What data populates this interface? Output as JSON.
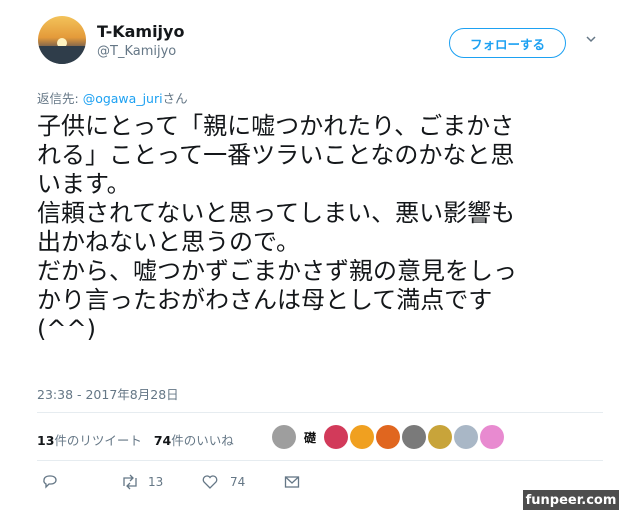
{
  "user": {
    "display_name": "T-Kamijyo",
    "handle": "@T_Kamijyo"
  },
  "follow_button": {
    "label": "フォローする"
  },
  "reply": {
    "prefix": "返信先: ",
    "mention": "@ogawa_juri",
    "suffix": "さん"
  },
  "tweet": {
    "text": "子供にとって「親に嘘つかれたり、ごまかさ\nれる」ことって一番ツラいことなのかなと思\nいます。\n信頼されてないと思ってしまい、悪い影響も\n出かねないと思うので。\nだから、嘘つかずごまかさず親の意見をしっ\nかり言ったおがわさんは母として満点です\n(^^)",
    "timestamp": "23:38 - 2017年8月28日"
  },
  "stats": {
    "retweet_count": "13",
    "retweet_label": "件のリツイート",
    "like_count": "74",
    "like_label": "件のいいね"
  },
  "likers": [
    {
      "name": "liker-1",
      "color": "#9e9e9e",
      "glyph": ""
    },
    {
      "name": "liker-2",
      "color": "#ffffff",
      "glyph": "礎"
    },
    {
      "name": "liker-3",
      "color": "#d23a5a",
      "glyph": ""
    },
    {
      "name": "liker-4",
      "color": "#f0a020",
      "glyph": ""
    },
    {
      "name": "liker-5",
      "color": "#e0661f",
      "glyph": ""
    },
    {
      "name": "liker-6",
      "color": "#7a7a7a",
      "glyph": ""
    },
    {
      "name": "liker-7",
      "color": "#c8a43a",
      "glyph": ""
    },
    {
      "name": "liker-8",
      "color": "#a9b7c6",
      "glyph": ""
    },
    {
      "name": "liker-9",
      "color": "#e88ad0",
      "glyph": ""
    }
  ],
  "actions": {
    "reply_icon": "reply-icon",
    "retweet_count": "13",
    "like_count": "74",
    "dm_icon": "message-icon"
  },
  "watermark": {
    "text": "funpeer.com"
  },
  "colors": {
    "accent": "#1da1f2",
    "muted": "#657786",
    "text": "#14171a"
  }
}
